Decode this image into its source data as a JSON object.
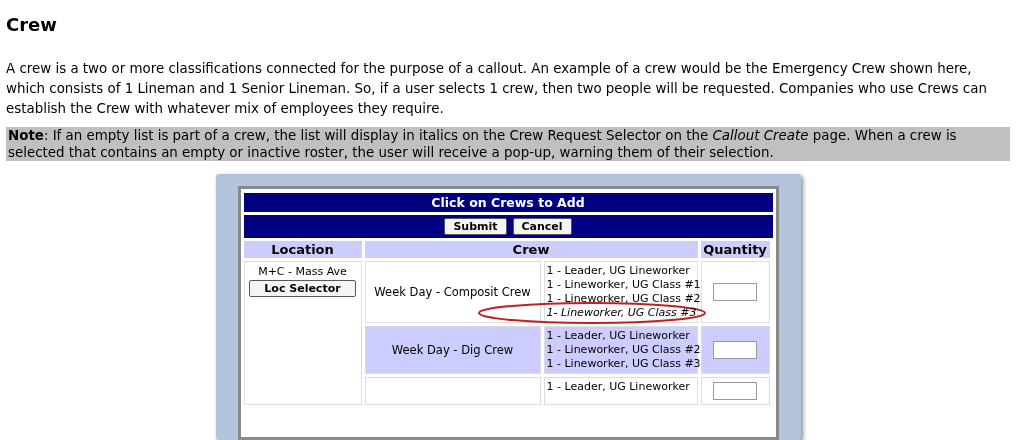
{
  "heading": "Crew",
  "intro": "A crew is a two or more classifications connected for the purpose of a callout. An example of a crew would be the Emergency Crew shown here, which consists of 1 Lineman and 1 Senior Lineman. So, if a user selects 1 crew, then two people will be requested. Companies who use Crews can establish the Crew with whatever mix of employees they require.",
  "note": "**Note**: If an empty list is part of a crew, the list will display in italics on the Crew Request Selector on the *Callout Create* page. When a crew is selected that contains an empty or inactive roster, the user will receive a pop-up, warning them of their selection.",
  "screenshot": {
    "title": "Click on Crews to Add",
    "buttons": [
      "Submit",
      "Cancel"
    ],
    "columns": [
      "Location",
      "Crew",
      "Quantity"
    ],
    "location": {
      "name": "M+C - Mass Ave",
      "button": "Loc Selector"
    },
    "rows": [
      {
        "name": "Week Day - Composit Crew",
        "shaded": false,
        "members": [
          {
            "text": "1 - Leader, UG Lineworker",
            "empty": false,
            "circled": false
          },
          {
            "text": "1 - Lineworker, UG Class #1",
            "empty": false,
            "circled": false
          },
          {
            "text": "1 - Lineworker, UG Class #2",
            "empty": false,
            "circled": false
          },
          {
            "text": "1- Lineworker, UG Class #3",
            "empty": true,
            "circled": true
          }
        ]
      },
      {
        "name": "Week Day - Dig Crew",
        "shaded": true,
        "members": [
          {
            "text": "1 - Leader, UG Lineworker",
            "empty": false,
            "circled": false
          },
          {
            "text": "1 - Lineworker, UG Class #2",
            "empty": false,
            "circled": false
          },
          {
            "text": "1 - Lineworker, UG Class #3",
            "empty": false,
            "circled": false
          }
        ]
      },
      {
        "shaded": false,
        "members": [
          {
            "text": "1 - Leader, UG Lineworker",
            "empty": false,
            "circled": false
          }
        ]
      }
    ]
  }
}
